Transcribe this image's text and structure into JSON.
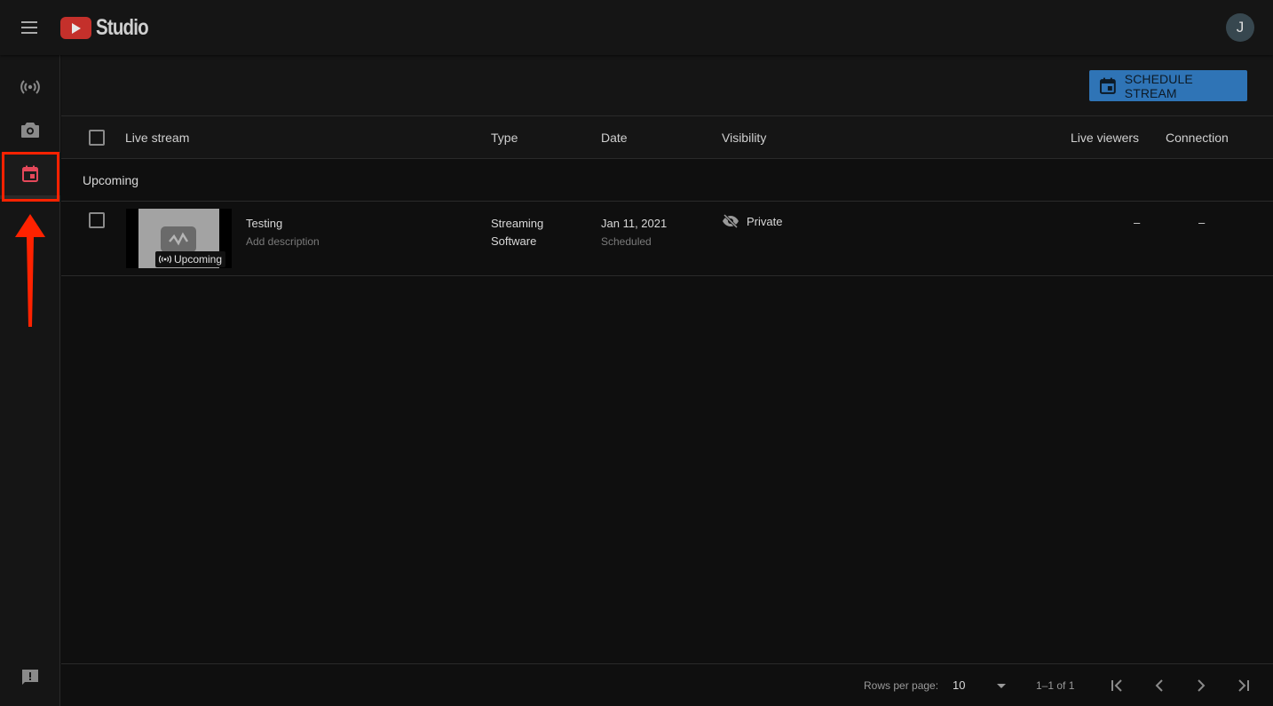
{
  "app": {
    "title": "Studio",
    "avatar_initial": "J"
  },
  "sidebar": {
    "items": [
      {
        "name": "stream-icon",
        "label": "Stream"
      },
      {
        "name": "webcam-icon",
        "label": "Webcam"
      },
      {
        "name": "manage-calendar-icon",
        "label": "Manage",
        "active": true
      }
    ],
    "feedback": {
      "name": "feedback-icon"
    }
  },
  "toolbar": {
    "schedule_label": "SCHEDULE STREAM"
  },
  "table": {
    "columns": [
      "Live stream",
      "Type",
      "Date",
      "Visibility",
      "Live viewers",
      "Connection"
    ],
    "section": "Upcoming",
    "rows": [
      {
        "title": "Testing",
        "description": "Add description",
        "badge": "Upcoming",
        "type_line1": "Streaming",
        "type_line2": "Software",
        "date": "Jan 11, 2021",
        "status": "Scheduled",
        "visibility": "Private",
        "live_viewers": "–",
        "connection": "–"
      }
    ]
  },
  "pagination": {
    "rows_per_page_label": "Rows per page:",
    "rows_per_page": "10",
    "range": "1–1 of 1"
  },
  "colors": {
    "accent": "#2f74b6",
    "active_icon": "#e5485a",
    "annotation": "#ff2200"
  }
}
